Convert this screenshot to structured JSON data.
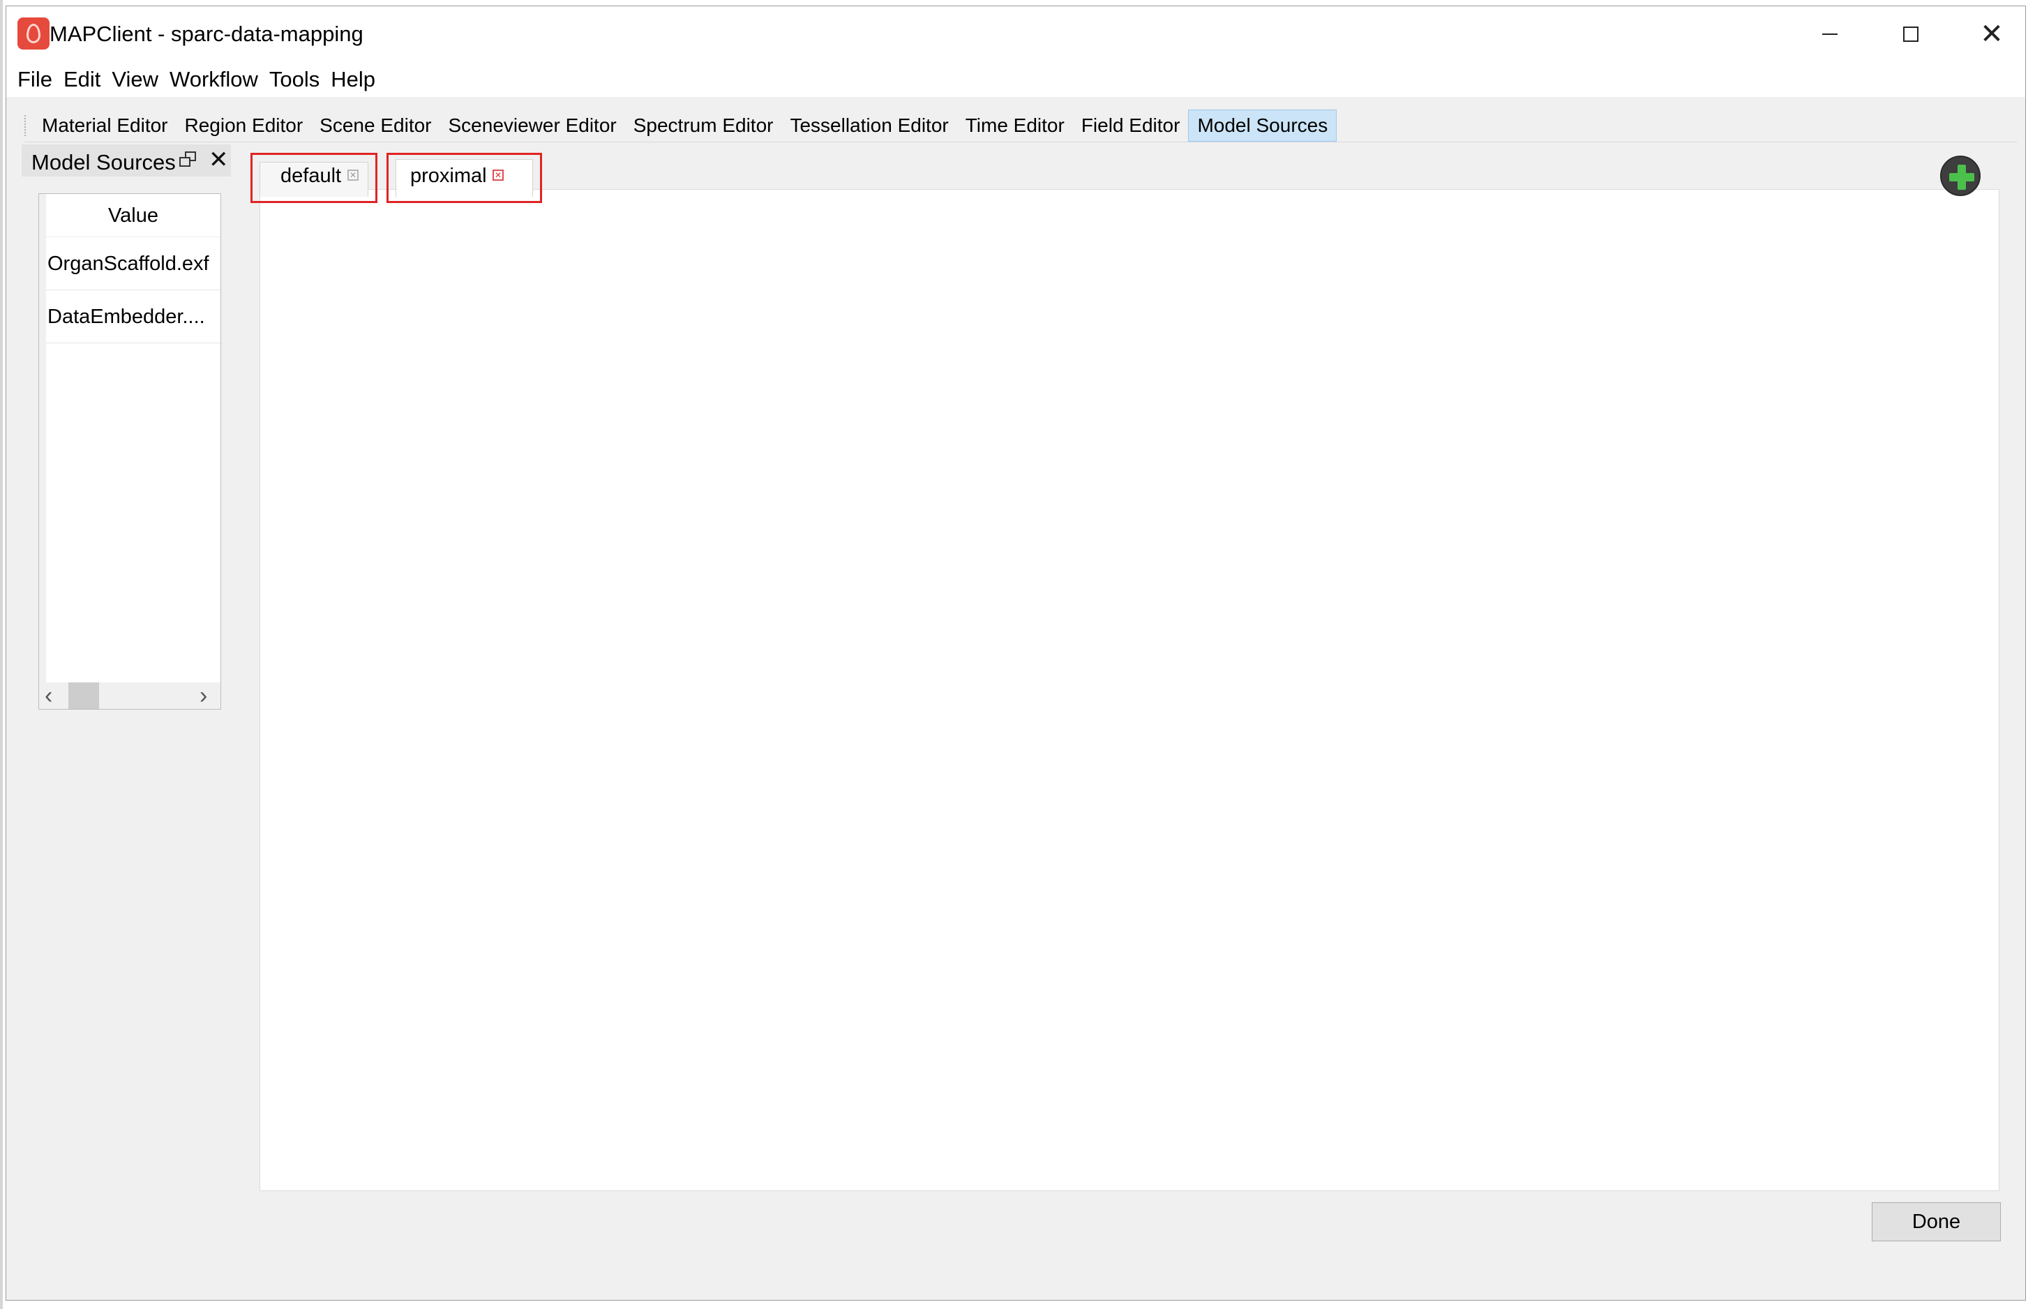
{
  "window": {
    "title": "MAPClient - sparc-data-mapping"
  },
  "menubar": {
    "items": [
      "File",
      "Edit",
      "View",
      "Workflow",
      "Tools",
      "Help"
    ]
  },
  "editor_tabs": {
    "items": [
      "Material Editor",
      "Region Editor",
      "Scene Editor",
      "Sceneviewer Editor",
      "Spectrum Editor",
      "Tessellation Editor",
      "Time Editor",
      "Field Editor",
      "Model Sources"
    ],
    "active": "Model Sources"
  },
  "dock": {
    "title": "Model Sources",
    "list": {
      "header": "Value",
      "rows": [
        "OrganScaffold.exf",
        "DataEmbedder...."
      ]
    }
  },
  "region_tabs": [
    {
      "label": "default",
      "active": false
    },
    {
      "label": "proximal",
      "active": true
    }
  ],
  "actions": {
    "done_label": "Done"
  },
  "icons": {
    "app": "mapclient-app-icon",
    "add": "add-region-icon",
    "add_color": "#4cc04c",
    "highlight_color": "#e02424"
  }
}
